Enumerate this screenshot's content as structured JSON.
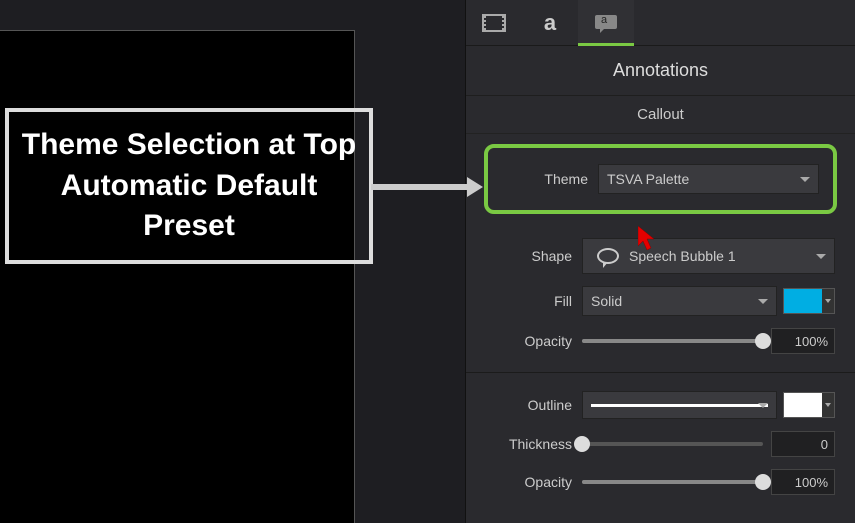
{
  "annotation": {
    "text": "Theme Selection at Top Automatic Default Preset"
  },
  "panel": {
    "title": "Annotations",
    "section": "Callout",
    "theme": {
      "label": "Theme",
      "value": "TSVA Palette"
    },
    "shape": {
      "label": "Shape",
      "value": "Speech Bubble 1"
    },
    "fill": {
      "label": "Fill",
      "mode": "Solid",
      "color": "#00aee3",
      "opacity_label": "Opacity",
      "opacity_value": "100%",
      "opacity_pct": 100
    },
    "outline": {
      "label": "Outline",
      "color": "#ffffff",
      "thickness_label": "Thickness",
      "thickness_value": "0",
      "thickness_pct": 0,
      "opacity_label": "Opacity",
      "opacity_value": "100%",
      "opacity_pct": 100
    }
  }
}
